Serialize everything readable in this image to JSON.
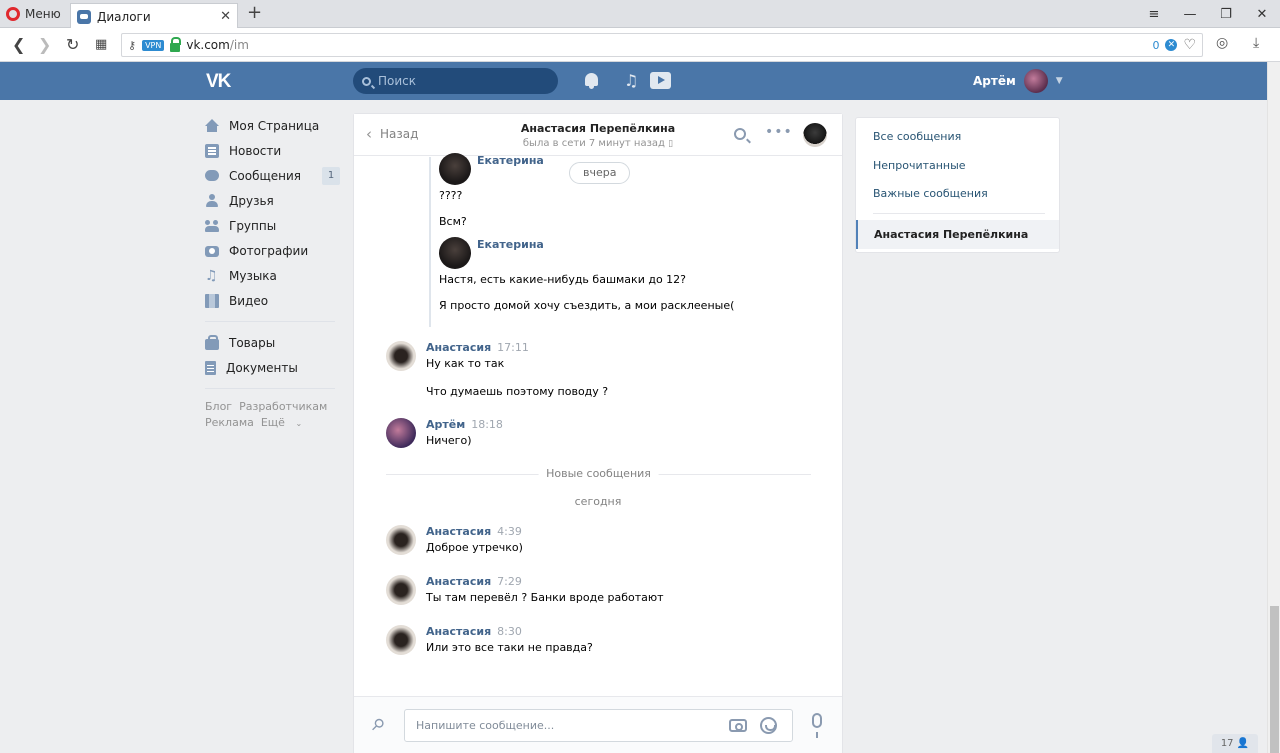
{
  "browser": {
    "menu_label": "Меню",
    "tab_title": "Диалоги",
    "url_host": "vk.com",
    "url_path": "/im",
    "vpn_label": "VPN",
    "adblock_count": "0"
  },
  "header": {
    "logo": "VK",
    "search_placeholder": "Поиск",
    "user_name": "Артём"
  },
  "leftnav": {
    "items": [
      {
        "label": "Моя Страница",
        "icon": "home-icon"
      },
      {
        "label": "Новости",
        "icon": "news-icon"
      },
      {
        "label": "Сообщения",
        "icon": "messages-icon",
        "badge": "1"
      },
      {
        "label": "Друзья",
        "icon": "friends-icon"
      },
      {
        "label": "Группы",
        "icon": "groups-icon"
      },
      {
        "label": "Фотографии",
        "icon": "photos-icon"
      },
      {
        "label": "Музыка",
        "icon": "music-icon"
      },
      {
        "label": "Видео",
        "icon": "video-icon"
      },
      {
        "label": "Товары",
        "icon": "market-icon"
      },
      {
        "label": "Документы",
        "icon": "documents-icon"
      }
    ],
    "footer": [
      "Блог",
      "Разработчикам",
      "Реклама",
      "Ещё"
    ]
  },
  "chat": {
    "back_label": "Назад",
    "peer_name": "Анастасия Перепёлкина",
    "peer_status": "была в сети 7 минут назад",
    "date_pill": "вчера",
    "forwarded": [
      {
        "author": "Екатерина",
        "lines": [
          "????",
          "Всм?"
        ]
      },
      {
        "author": "Екатерина",
        "lines": [
          "Настя, есть какие-нибудь башмаки до 12?",
          "Я просто домой хочу съездить, а мои расклееные("
        ]
      }
    ],
    "messages": [
      {
        "author": "Анастасия",
        "time": "17:11",
        "lines": [
          "Ну как то так",
          "Что думаешь поэтому поводу ?"
        ]
      },
      {
        "author": "Артём",
        "time": "18:18",
        "lines": [
          "Ничего)"
        ]
      },
      {
        "author": "Анастасия",
        "time": "4:39",
        "lines": [
          "Доброе утречко)"
        ]
      },
      {
        "author": "Анастасия",
        "time": "7:29",
        "lines": [
          "Ты там перевёл ? Банки вроде работают"
        ]
      },
      {
        "author": "Анастасия",
        "time": "8:30",
        "lines": [
          "Или это все таки не правда?"
        ]
      }
    ],
    "new_messages_label": "Новые сообщения",
    "today_label": "сегодня",
    "input_placeholder": "Напишите сообщение..."
  },
  "filters": {
    "items": [
      "Все сообщения",
      "Непрочитанные",
      "Важные сообщения"
    ],
    "active": "Анастасия Перепёлкина"
  },
  "online_count": "17",
  "colors": {
    "vk_blue": "#4a76a8",
    "link_blue": "#42648b",
    "page_bg": "#edeef0"
  }
}
